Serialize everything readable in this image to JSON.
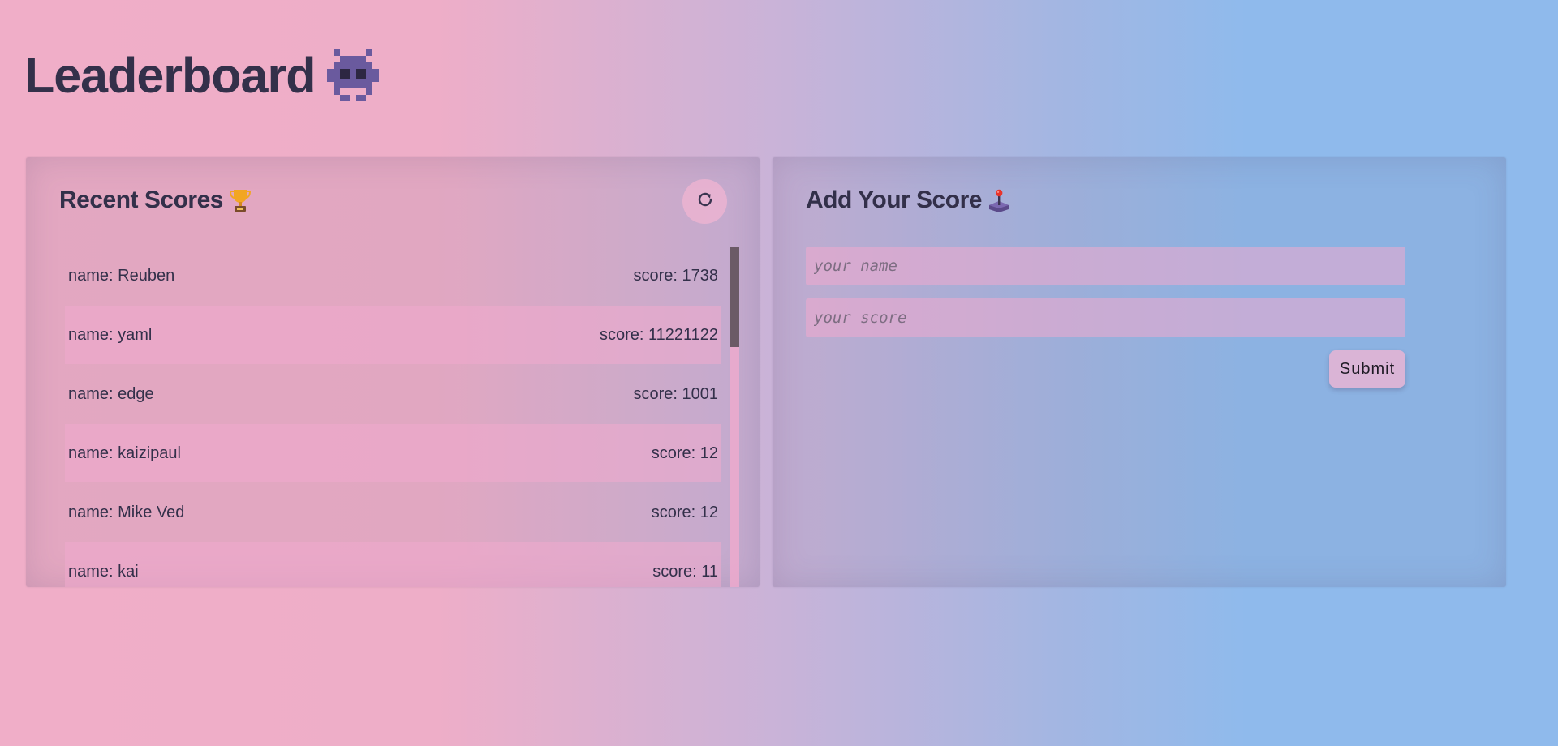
{
  "page": {
    "title": "Leaderboard",
    "title_icon": "space-invader-icon"
  },
  "recent": {
    "title": "Recent Scores",
    "title_icon": "trophy-icon",
    "refresh_icon": "refresh-icon",
    "rows": [
      {
        "name": "name: Reuben",
        "score": "score: 1738"
      },
      {
        "name": "name: yaml",
        "score": "score: 11221122"
      },
      {
        "name": "name: edge",
        "score": "score: 1001"
      },
      {
        "name": "name: kaizipaul",
        "score": "score: 12"
      },
      {
        "name": "name: Mike Ved",
        "score": "score: 12"
      },
      {
        "name": "name: kai",
        "score": "score: 11"
      }
    ]
  },
  "add": {
    "title": "Add Your Score",
    "title_icon": "joystick-icon",
    "name_placeholder": "your name",
    "score_placeholder": "your score",
    "submit_label": "Submit"
  },
  "colors": {
    "text": "#33304a",
    "row_alt": "#f0aacd",
    "scroll_thumb": "#6b5a66",
    "invader": "#6a5a9e"
  }
}
